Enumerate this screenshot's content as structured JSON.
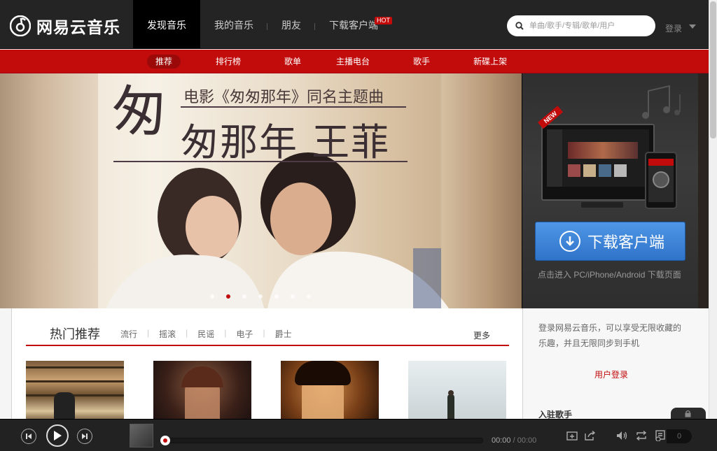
{
  "header": {
    "logo_text": "网易云音乐",
    "nav": [
      {
        "label": "发现音乐"
      },
      {
        "label": "我的音乐"
      },
      {
        "label": "朋友"
      },
      {
        "label": "下载客户端",
        "badge": "HOT"
      }
    ],
    "search_placeholder": "单曲/歌手/专辑/歌单/用户",
    "login": "登录"
  },
  "subnav": {
    "items": [
      "推荐",
      "排行榜",
      "歌单",
      "主播电台",
      "歌手",
      "新碟上架"
    ]
  },
  "banner": {
    "subtitle": "电影《匆匆那年》同名主题曲",
    "title_first": "匆",
    "title_rest": "匆那年 王菲",
    "dots_count": 7,
    "active_dot": 2
  },
  "download_panel": {
    "new_tag": "NEW",
    "button_label": "下载客户端",
    "hint": "点击进入 PC/iPhone/Android 下载页面"
  },
  "hot": {
    "title": "热门推荐",
    "tags": [
      "流行",
      "摇滚",
      "民谣",
      "电子",
      "爵士"
    ],
    "more": "更多"
  },
  "side": {
    "text": "登录网易云音乐，可以享受无限收藏的乐趣，并且无限同步到手机",
    "login_link": "用户登录",
    "section_title": "入驻歌手"
  },
  "player": {
    "time_current": "00:00",
    "time_total": "00:00",
    "progress": 0,
    "playlist_count": "0"
  },
  "colors": {
    "accent_red": "#c20c0c",
    "topbar": "#242424",
    "download_blue": "#2f73c9"
  }
}
